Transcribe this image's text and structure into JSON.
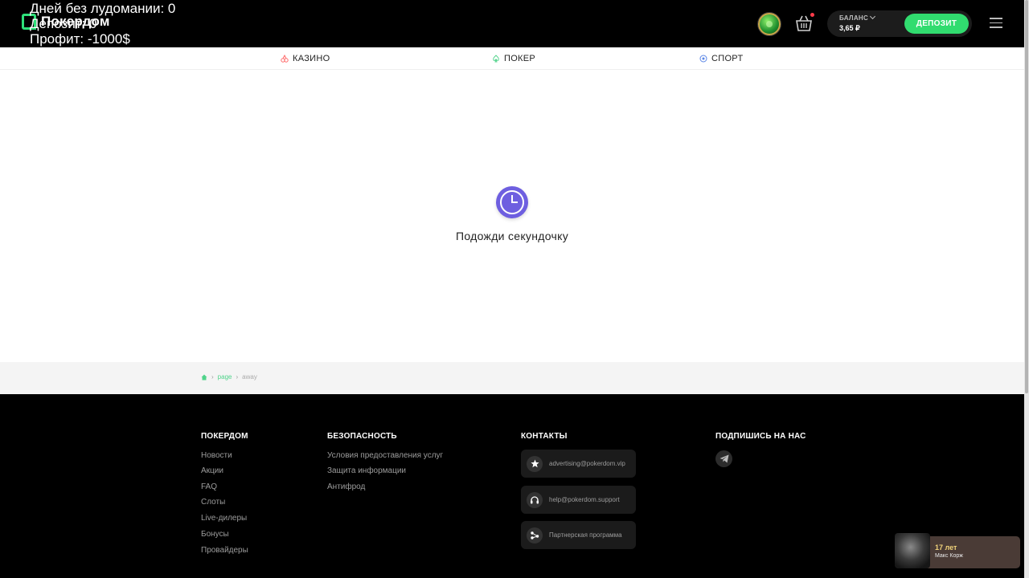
{
  "header": {
    "logo_text": "Покердом",
    "balance_label": "БАЛАНС",
    "balance_value": "3,65 ₽",
    "deposit_label": "ДЕПОЗИТ"
  },
  "overlay": {
    "line1": "Дней без лудомании: 0",
    "line2": "Депозит: 0",
    "line3": "Профит: -1000$"
  },
  "subnav": {
    "items": [
      {
        "label": "КАЗИНО"
      },
      {
        "label": "ПОКЕР"
      },
      {
        "label": "СПОРТ"
      }
    ]
  },
  "main": {
    "loading_text": "Подожди секундочку"
  },
  "breadcrumb": {
    "items": [
      "page",
      "away"
    ]
  },
  "footer": {
    "pokerdom": {
      "title": "ПОКЕРДОМ",
      "links": [
        "Новости",
        "Акции",
        "FAQ",
        "Слоты",
        "Live-дилеры",
        "Бонусы",
        "Провайдеры"
      ]
    },
    "security": {
      "title": "БЕЗОПАСНОСТЬ",
      "links": [
        "Условия предоставления услуг",
        "Защита информации",
        "Антифрод"
      ]
    },
    "contacts": {
      "title": "КОНТАКТЫ",
      "items": [
        {
          "label": "advertising@pokerdom.vip",
          "icon": "star-icon"
        },
        {
          "label": "help@pokerdom.support",
          "icon": "headset-icon"
        },
        {
          "label": "Партнерская программа",
          "icon": "share-icon"
        }
      ]
    },
    "social": {
      "title": "ПОДПИШИСЬ НА НАС",
      "icon": "telegram-icon"
    }
  },
  "widget": {
    "title": "17 лет",
    "subtitle": "Макс Корж"
  },
  "colors": {
    "accent_green": "#31dc6f",
    "loader_purple": "#6e5fe0"
  }
}
